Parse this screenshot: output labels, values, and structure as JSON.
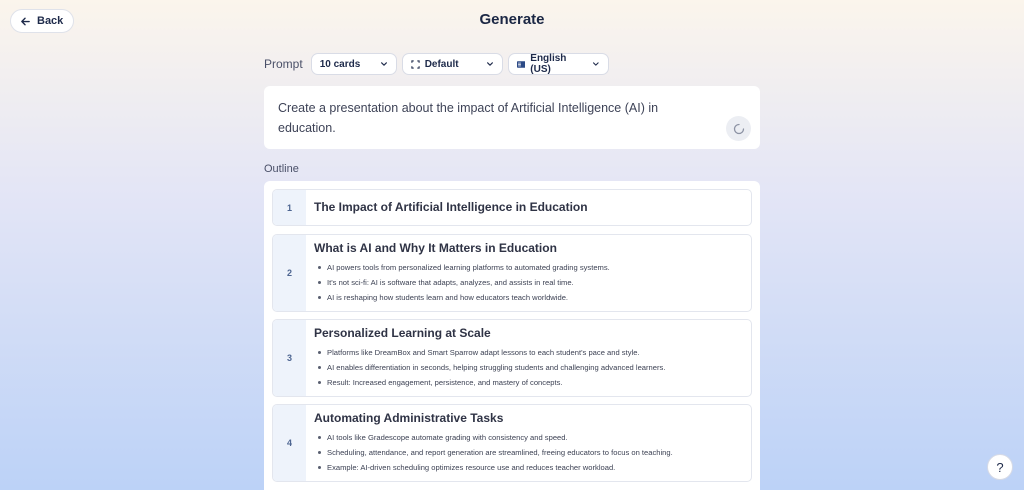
{
  "header": {
    "back_label": "Back",
    "title": "Generate"
  },
  "controls": {
    "prompt_label": "Prompt",
    "cards": "10 cards",
    "theme": "Default",
    "language": "English (US)"
  },
  "prompt": {
    "text": "Create a presentation about the impact of Artificial Intelligence (AI) in education."
  },
  "outline": {
    "label": "Outline",
    "cards": [
      {
        "number": "1",
        "title": "The Impact of Artificial Intelligence in Education",
        "bullets": []
      },
      {
        "number": "2",
        "title": "What is AI and Why It Matters in Education",
        "bullets": [
          "AI powers tools from personalized learning platforms to automated grading systems.",
          "It's not sci-fi: AI is software that adapts, analyzes, and assists in real time.",
          "AI is reshaping how students learn and how educators teach worldwide."
        ]
      },
      {
        "number": "3",
        "title": "Personalized Learning at Scale",
        "bullets": [
          "Platforms like DreamBox and Smart Sparrow adapt lessons to each student's pace and style.",
          "AI enables differentiation in seconds, helping struggling students and challenging advanced learners.",
          "Result: Increased engagement, persistence, and mastery of concepts."
        ]
      },
      {
        "number": "4",
        "title": "Automating Administrative Tasks",
        "bullets": [
          "AI tools like Gradescope automate grading with consistency and speed.",
          "Scheduling, attendance, and report generation are streamlined, freeing educators to focus on teaching.",
          "Example: AI-driven scheduling optimizes resource use and reduces teacher workload."
        ]
      }
    ]
  },
  "help": {
    "label": "?"
  },
  "icons": {
    "back": "arrow-left-icon",
    "theme": "dashed-frame-icon",
    "language": "flag-icon",
    "dropdown": "chevron-down-icon",
    "loading": "spinner-icon"
  },
  "colors": {
    "accent": "#1e2a4a",
    "number_bg": "#eef3fb"
  }
}
